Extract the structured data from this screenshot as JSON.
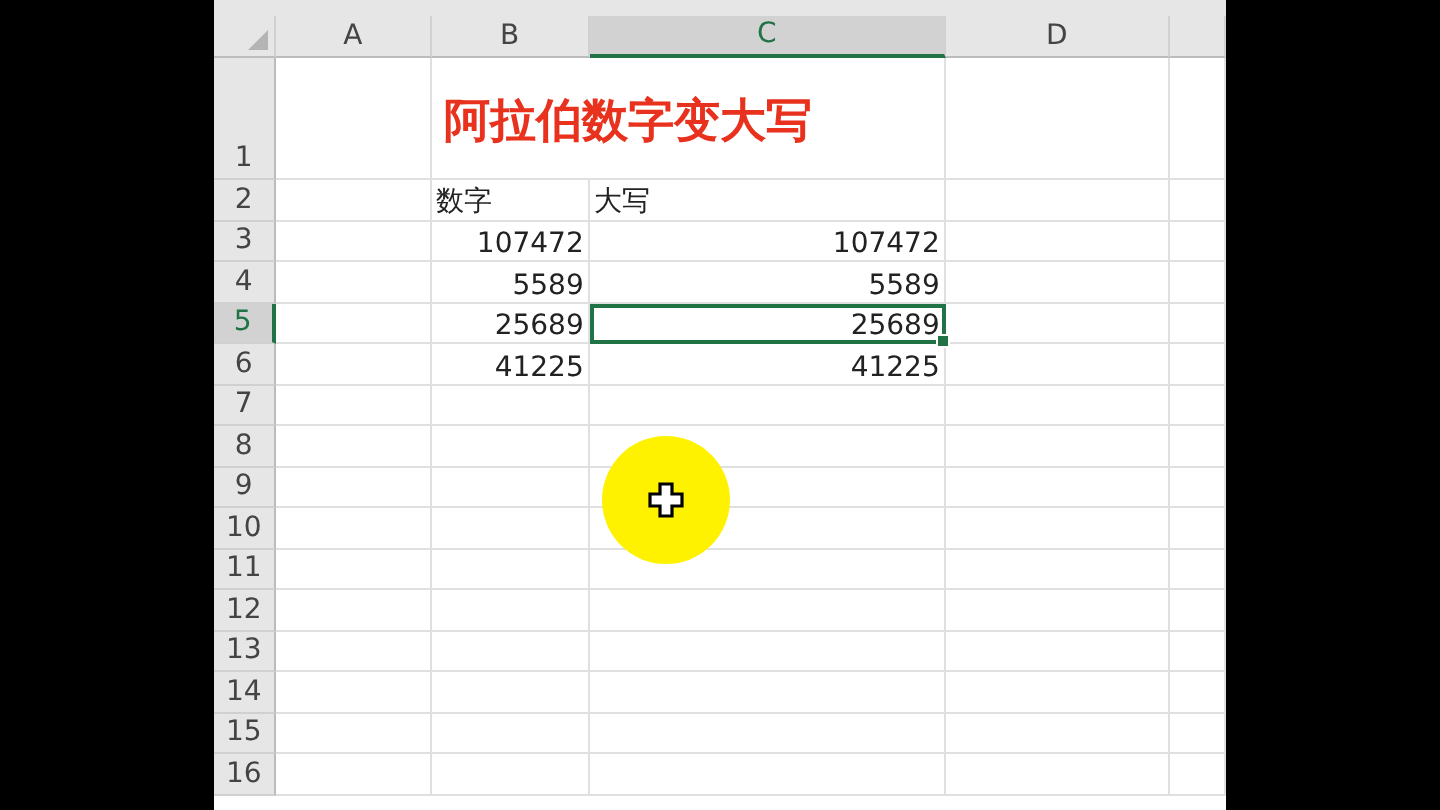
{
  "columns": [
    {
      "label": "A",
      "selected": false
    },
    {
      "label": "B",
      "selected": false
    },
    {
      "label": "C",
      "selected": true
    },
    {
      "label": "D",
      "selected": false
    }
  ],
  "rows": [
    {
      "label": "1",
      "selected": false,
      "cells": {
        "B": {
          "kind": "title",
          "text": "阿拉伯数字变大写",
          "selected": false
        }
      }
    },
    {
      "label": "2",
      "selected": false,
      "cells": {
        "B": {
          "kind": "text",
          "text": "数字",
          "selected": false
        },
        "C": {
          "kind": "text",
          "text": "大写",
          "selected": false
        }
      }
    },
    {
      "label": "3",
      "selected": false,
      "cells": {
        "B": {
          "kind": "number",
          "text": "107472",
          "selected": false
        },
        "C": {
          "kind": "number",
          "text": "107472",
          "selected": false
        }
      }
    },
    {
      "label": "4",
      "selected": false,
      "cells": {
        "B": {
          "kind": "number",
          "text": "5589",
          "selected": false
        },
        "C": {
          "kind": "number",
          "text": "5589",
          "selected": false
        }
      }
    },
    {
      "label": "5",
      "selected": true,
      "cells": {
        "B": {
          "kind": "number",
          "text": "25689",
          "selected": false
        },
        "C": {
          "kind": "number",
          "text": "25689",
          "selected": true
        }
      }
    },
    {
      "label": "6",
      "selected": false,
      "cells": {
        "B": {
          "kind": "number",
          "text": "41225",
          "selected": false
        },
        "C": {
          "kind": "number",
          "text": "41225",
          "selected": false
        }
      }
    },
    {
      "label": "7",
      "selected": false
    },
    {
      "label": "8",
      "selected": false
    },
    {
      "label": "9",
      "selected": false
    },
    {
      "label": "10",
      "selected": false
    },
    {
      "label": "11",
      "selected": false
    },
    {
      "label": "12",
      "selected": false
    },
    {
      "label": "13",
      "selected": false
    },
    {
      "label": "14",
      "selected": false
    },
    {
      "label": "15",
      "selected": false
    },
    {
      "label": "16",
      "selected": false
    }
  ]
}
